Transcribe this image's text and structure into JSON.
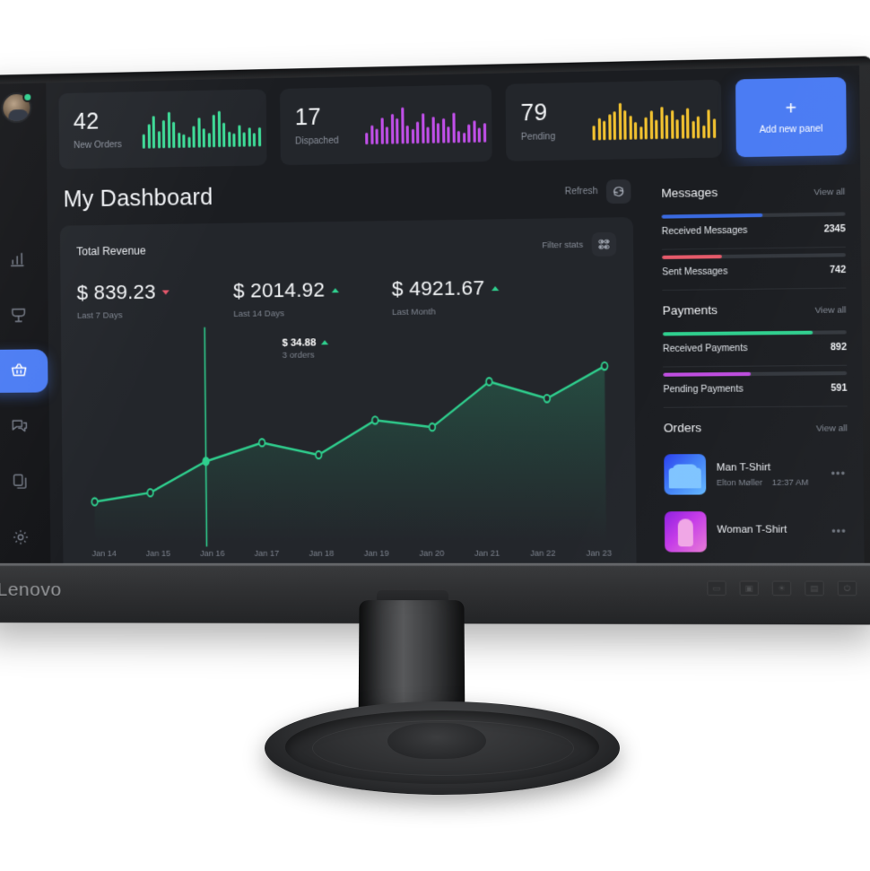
{
  "monitor": {
    "brand": "Lenovo",
    "osd_buttons": [
      "input-icon",
      "display-icon",
      "brightness-icon",
      "menu-icon",
      "power-icon"
    ]
  },
  "sidebar": {
    "avatar_name": "user-avatar",
    "status": "online",
    "items": [
      {
        "name": "sidebar-item-analytics",
        "icon": "bar-chart-icon",
        "active": false
      },
      {
        "name": "sidebar-item-location",
        "icon": "pin-icon",
        "active": false
      },
      {
        "name": "sidebar-item-orders",
        "icon": "basket-icon",
        "active": true
      },
      {
        "name": "sidebar-item-messages",
        "icon": "chat-icon",
        "active": false
      },
      {
        "name": "sidebar-item-documents",
        "icon": "documents-icon",
        "active": false
      },
      {
        "name": "sidebar-item-settings",
        "icon": "gear-icon",
        "active": false
      }
    ]
  },
  "topstats": {
    "cards": [
      {
        "value": "42",
        "label": "New Orders",
        "color": "#3ddc97",
        "spark": [
          13,
          22,
          30,
          16,
          26,
          33,
          24,
          14,
          12,
          10,
          20,
          27,
          17,
          13,
          30,
          33,
          22,
          14,
          12,
          20,
          13,
          17,
          12,
          17
        ]
      },
      {
        "value": "17",
        "label": "Dispached",
        "color": "#c04fe8",
        "spark": [
          12,
          19,
          15,
          26,
          17,
          30,
          25,
          36,
          18,
          14,
          22,
          30,
          16,
          26,
          20,
          24,
          16,
          30,
          12,
          10,
          18,
          22,
          14,
          19
        ]
      },
      {
        "value": "79",
        "label": "Pending",
        "color": "#f2c230",
        "spark": [
          14,
          20,
          18,
          24,
          26,
          34,
          27,
          22,
          16,
          12,
          20,
          26,
          18,
          30,
          22,
          26,
          18,
          22,
          28,
          16,
          20,
          12,
          26,
          18
        ]
      }
    ],
    "add_panel": {
      "label": "Add new panel",
      "icon": "plus-icon",
      "color": "#4b7cf3"
    }
  },
  "header": {
    "title": "My Dashboard",
    "refresh_label": "Refresh",
    "refresh_icon": "refresh-icon"
  },
  "revenue": {
    "title": "Total Revenue",
    "filter_label": "Filter stats",
    "filter_icon": "sliders-icon",
    "figures": [
      {
        "value": "$ 839.23",
        "sub": "Last 7 Days",
        "trend": "down"
      },
      {
        "value": "$ 2014.92",
        "sub": "Last 14 Days",
        "trend": "up"
      },
      {
        "value": "$ 4921.67",
        "sub": "Last Month",
        "trend": "up"
      }
    ],
    "tooltip": {
      "value": "$ 34.88",
      "sub": "3 orders",
      "trend": "up"
    }
  },
  "chart_data": {
    "type": "line",
    "title": "Total Revenue",
    "xlabel": "",
    "ylabel": "",
    "grid": false,
    "legend": "none",
    "line_color": "#2fcf8e",
    "categories": [
      "Jan 14",
      "Jan 15",
      "Jan 16",
      "Jan 17",
      "Jan 18",
      "Jan 19",
      "Jan 20",
      "Jan 21",
      "Jan 22",
      "Jan 23"
    ],
    "values": [
      12.4,
      15.1,
      24.6,
      30.2,
      26.4,
      36.8,
      34.6,
      48.2,
      43.0,
      52.6
    ],
    "ylim": [
      0,
      60
    ],
    "highlight_index": 2,
    "highlight_label": "$ 34.88",
    "highlight_sub": "3 orders",
    "annotations": [
      {
        "x": "Jan 16",
        "text": "$ 34.88 / 3 orders",
        "type": "crosshair"
      }
    ]
  },
  "rightbar": {
    "messages": {
      "title": "Messages",
      "view_all": "View all",
      "rows": [
        {
          "name": "Received Messages",
          "count": "2345",
          "pct": 55,
          "color": "#3a6ae0"
        },
        {
          "name": "Sent Messages",
          "count": "742",
          "pct": 33,
          "color": "#e55a6a"
        }
      ]
    },
    "payments": {
      "title": "Payments",
      "view_all": "View all",
      "rows": [
        {
          "name": "Received Payments",
          "count": "892",
          "pct": 82,
          "color": "#2fcf8e"
        },
        {
          "name": "Pending Payments",
          "count": "591",
          "pct": 48,
          "color": "#bf4de0"
        }
      ]
    },
    "orders": {
      "title": "Orders",
      "view_all": "View all",
      "items": [
        {
          "name": "Man T-Shirt",
          "customer": "Elton Møller",
          "time": "12:37 AM",
          "thumb": "man-tshirt-thumb",
          "menu": "•••"
        },
        {
          "name": "Woman T-Shirt",
          "customer": "",
          "time": "",
          "thumb": "woman-tshirt-thumb",
          "menu": "•••"
        }
      ]
    }
  }
}
